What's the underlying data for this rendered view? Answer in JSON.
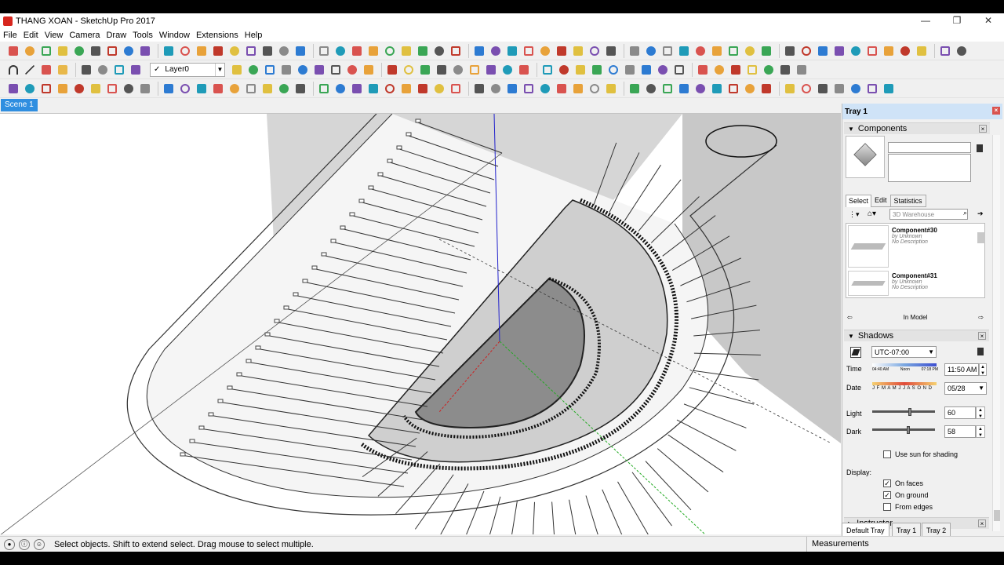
{
  "window": {
    "title": "THANG XOAN - SketchUp Pro 2017",
    "controls": [
      "—",
      "❐",
      "✕"
    ]
  },
  "menu": [
    "File",
    "Edit",
    "View",
    "Camera",
    "Draw",
    "Tools",
    "Window",
    "Extensions",
    "Help"
  ],
  "toolbar": {
    "layer_value": "Layer0"
  },
  "scene": {
    "tab_label": "Scene 1"
  },
  "tray": {
    "title": "Tray 1",
    "components": {
      "header": "Components",
      "tabs": [
        "Select",
        "Edit",
        "Statistics"
      ],
      "search_placeholder": "3D Warehouse",
      "items": [
        {
          "name": "Component#30",
          "by": "by Unknown",
          "desc": "No Description"
        },
        {
          "name": "Component#31",
          "by": "by Unknown",
          "desc": "No Description"
        }
      ],
      "in_model": "In Model"
    },
    "shadows": {
      "header": "Shadows",
      "timezone": "UTC-07:00",
      "time_label": "Time",
      "time_marks": [
        "04:40 AM",
        "Noon",
        "07:18 PM"
      ],
      "time_value": "11:50 AM",
      "date_label": "Date",
      "months": "J F M A M J J A S O N D",
      "date_value": "05/28",
      "light_label": "Light",
      "light_value": "60",
      "light_level": 60,
      "dark_label": "Dark",
      "dark_value": "58",
      "dark_level": 58,
      "use_sun_label": "Use sun for shading",
      "display_label": "Display:",
      "on_faces_label": "On faces",
      "on_ground_label": "On ground",
      "from_edges_label": "From edges"
    },
    "instructor": {
      "header": "Instructor"
    },
    "bottom_tabs": [
      "Default Tray",
      "Tray 1",
      "Tray 2"
    ]
  },
  "status": {
    "text": "Select objects. Shift to extend select. Drag mouse to select multiple.",
    "measurements_label": "Measurements"
  }
}
